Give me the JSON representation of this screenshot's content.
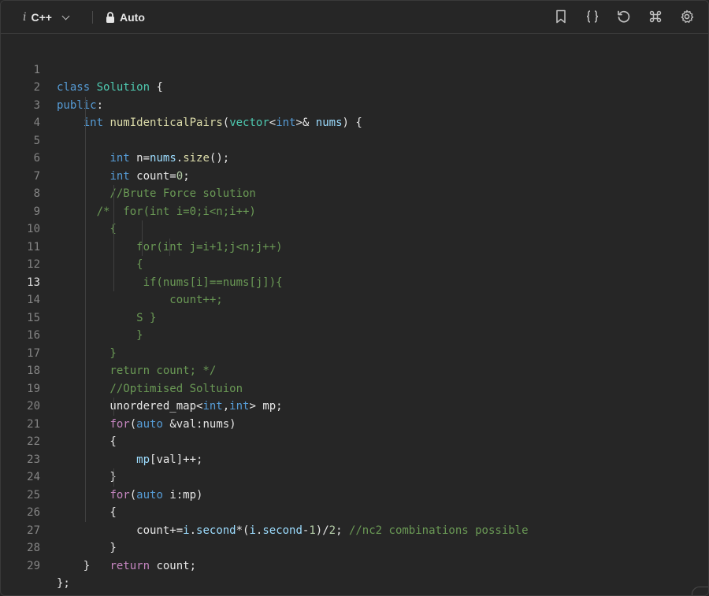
{
  "toolbar": {
    "language_icon": "i",
    "language": "C++",
    "mode": "Auto",
    "icons": [
      "bookmark-icon",
      "braces-icon",
      "reset-icon",
      "command-icon",
      "gear-icon"
    ]
  },
  "editor": {
    "active_line": 13,
    "line_numbers": [
      "1",
      "2",
      "3",
      "4",
      "5",
      "6",
      "7",
      "8",
      "9",
      "10",
      "11",
      "12",
      "13",
      "14",
      "15",
      "16",
      "17",
      "18",
      "19",
      "20",
      "21",
      "22",
      "23",
      "24",
      "25",
      "26",
      "27",
      "28",
      "29"
    ],
    "lines": [
      "class Solution {",
      "public:",
      "    int numIdenticalPairs(vector<int>& nums) {",
      "        int n=nums.size();",
      "        int count=0;",
      "        //Brute Force solution",
      "      /*  for(int i=0;i<n;i++)",
      "        {",
      "            for(int j=i+1;j<n;j++)",
      "            {",
      "             if(nums[i]==nums[j]){",
      "                 count++;",
      "            S }",
      "            }",
      "        }",
      "        return count; */",
      "        //Optimised Soltuion",
      "        unordered_map<int,int> mp;",
      "        for(auto &val:nums)",
      "        {",
      "            mp[val]++;",
      "        }",
      "        for(auto i:mp)",
      "        {",
      "            count+=i.second*(i.second-1)/2; //nc2 combinations possible",
      "        }",
      "        return count;",
      "    }",
      "};"
    ]
  }
}
